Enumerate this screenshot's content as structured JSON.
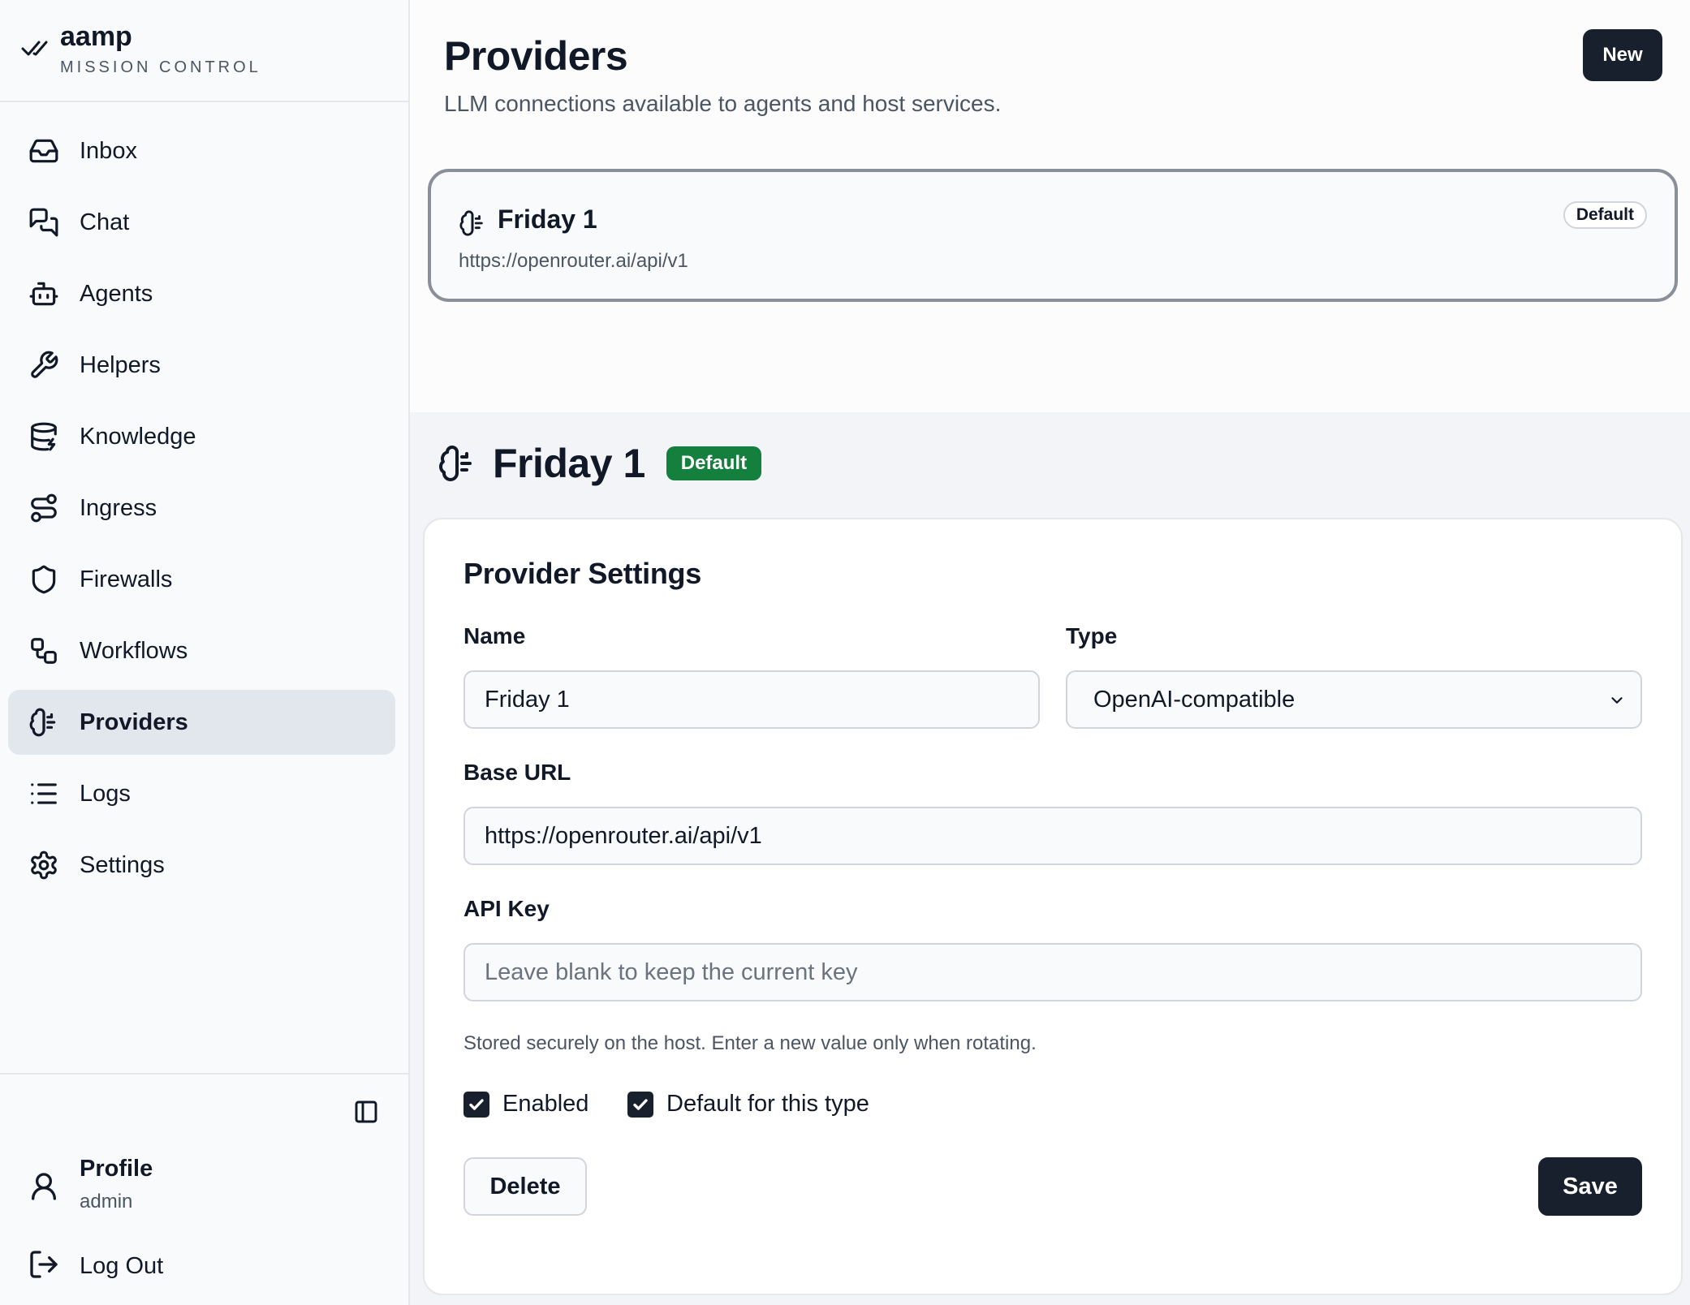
{
  "brand": {
    "name": "aamp",
    "subtitle": "MISSION CONTROL"
  },
  "sidebar": {
    "items": [
      {
        "label": "Inbox",
        "icon": "inbox-icon"
      },
      {
        "label": "Chat",
        "icon": "chat-icon"
      },
      {
        "label": "Agents",
        "icon": "bot-icon"
      },
      {
        "label": "Helpers",
        "icon": "wrench-icon"
      },
      {
        "label": "Knowledge",
        "icon": "database-icon"
      },
      {
        "label": "Ingress",
        "icon": "route-icon"
      },
      {
        "label": "Firewalls",
        "icon": "shield-icon"
      },
      {
        "label": "Workflows",
        "icon": "workflow-icon"
      },
      {
        "label": "Providers",
        "icon": "brain-icon",
        "active": true
      },
      {
        "label": "Logs",
        "icon": "list-icon"
      },
      {
        "label": "Settings",
        "icon": "gear-icon"
      }
    ],
    "profile": {
      "name": "Profile",
      "role": "admin"
    },
    "logout_label": "Log Out"
  },
  "header": {
    "title": "Providers",
    "subtitle": "LLM connections available to agents and host services.",
    "new_label": "New"
  },
  "provider_list": [
    {
      "name": "Friday 1",
      "url": "https://openrouter.ai/api/v1",
      "badge": "Default"
    }
  ],
  "detail": {
    "title": "Friday 1",
    "badge": "Default",
    "card_title": "Provider Settings",
    "name_label": "Name",
    "name_value": "Friday 1",
    "type_label": "Type",
    "type_value": "OpenAI-compatible",
    "base_url_label": "Base URL",
    "base_url_value": "https://openrouter.ai/api/v1",
    "api_key_label": "API Key",
    "api_key_placeholder": "Leave blank to keep the current key",
    "hint": "Stored securely on the host. Enter a new value only when rotating.",
    "enabled_label": "Enabled",
    "enabled": true,
    "default_label": "Default for this type",
    "default": true,
    "delete_label": "Delete",
    "save_label": "Save"
  },
  "colors": {
    "primary": "#18202e",
    "success": "#15803d",
    "active_nav": "#e2e6ed"
  }
}
